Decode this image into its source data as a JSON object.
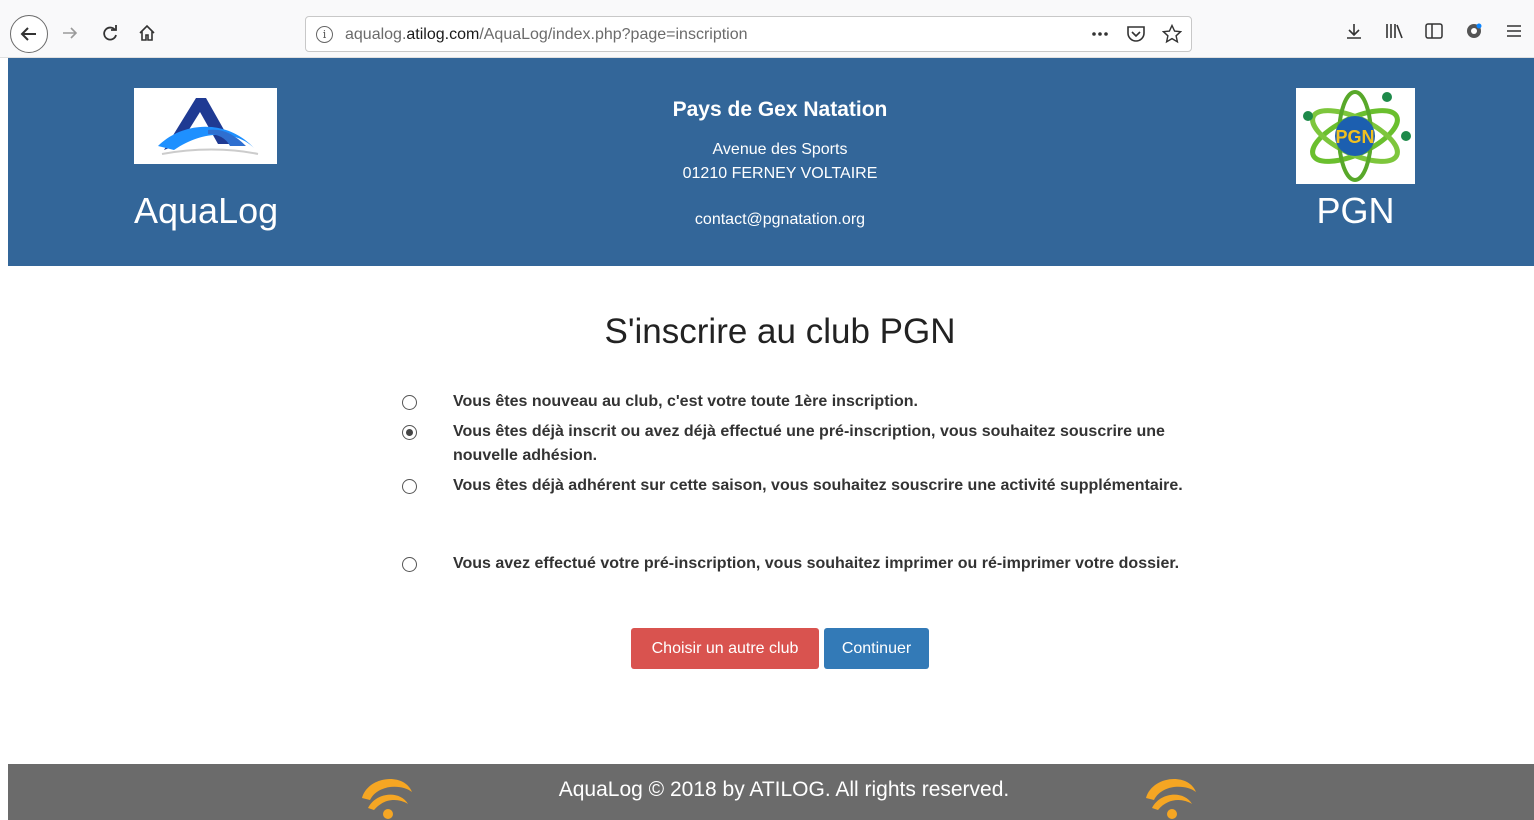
{
  "browser": {
    "url_prefix": "aqualog.",
    "url_domain": "atilog.com",
    "url_path": "/AquaLog/index.php?page=inscription",
    "back_icon": "arrow-left-icon",
    "forward_icon": "arrow-right-icon",
    "reload_icon": "reload-icon",
    "home_icon": "home-icon"
  },
  "header": {
    "left_logo_label": "AquaLog",
    "club_name": "Pays de Gex Natation",
    "address_line1": "Avenue des Sports",
    "address_line2": "01210 FERNEY VOLTAIRE",
    "email": "contact@pgnatation.org",
    "right_logo_label": "PGN",
    "right_logo_badge": "PGN",
    "background_color": "#336699"
  },
  "main": {
    "title": "S'inscrire au club PGN",
    "options": [
      {
        "label": "Vous êtes nouveau au club, c'est votre toute 1ère inscription.",
        "checked": false
      },
      {
        "label": "Vous êtes déjà inscrit ou avez déjà effectué une pré-inscription, vous souhaitez souscrire une nouvelle adhésion.",
        "checked": true
      },
      {
        "label": "Vous êtes déjà adhérent sur cette saison, vous souhaitez souscrire une activité supplémentaire.",
        "checked": false
      },
      {
        "label": "Vous avez effectué votre pré-inscription, vous souhaitez imprimer ou ré-imprimer votre dossier.",
        "checked": false
      }
    ],
    "choose_club_button": "Choisir un autre club",
    "continue_button": "Continuer"
  },
  "footer": {
    "text": "AquaLog © 2018 by ATILOG. All rights reserved."
  }
}
